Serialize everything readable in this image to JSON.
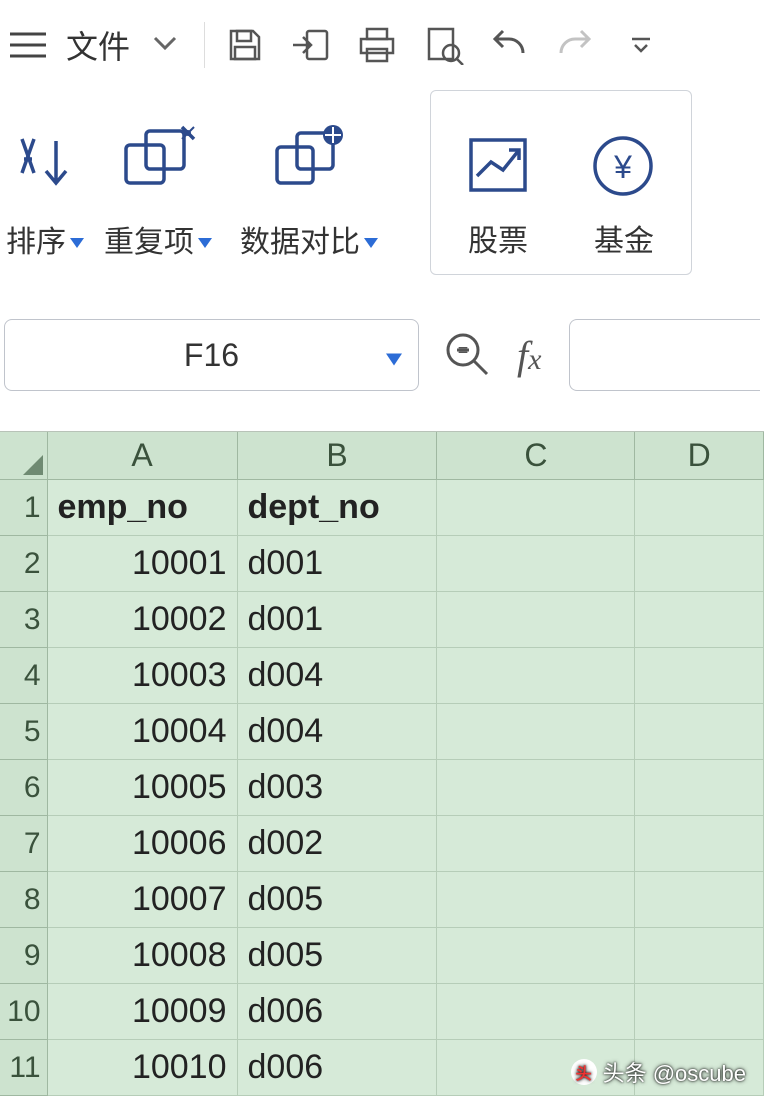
{
  "toolbar": {
    "file_label": "文件"
  },
  "ribbon": {
    "sort_label": "排序",
    "duplicates_label": "重复项",
    "compare_label": "数据对比",
    "stock_label": "股票",
    "fund_label": "基金"
  },
  "namebox": {
    "value": "F16"
  },
  "sheet": {
    "columns": [
      "A",
      "B",
      "C",
      "D"
    ],
    "rows": [
      {
        "n": "1",
        "A": "emp_no",
        "B": "dept_no",
        "header": true
      },
      {
        "n": "2",
        "A": "10001",
        "B": "d001"
      },
      {
        "n": "3",
        "A": "10002",
        "B": "d001"
      },
      {
        "n": "4",
        "A": "10003",
        "B": "d004"
      },
      {
        "n": "5",
        "A": "10004",
        "B": "d004"
      },
      {
        "n": "6",
        "A": "10005",
        "B": "d003"
      },
      {
        "n": "7",
        "A": "10006",
        "B": "d002"
      },
      {
        "n": "8",
        "A": "10007",
        "B": "d005"
      },
      {
        "n": "9",
        "A": "10008",
        "B": "d005"
      },
      {
        "n": "10",
        "A": "10009",
        "B": "d006"
      },
      {
        "n": "11",
        "A": "10010",
        "B": "d006"
      }
    ]
  },
  "watermark": {
    "text": "头条 @oscube"
  },
  "chart_data": {
    "type": "table",
    "title": "",
    "columns": [
      "emp_no",
      "dept_no"
    ],
    "rows": [
      [
        10001,
        "d001"
      ],
      [
        10002,
        "d001"
      ],
      [
        10003,
        "d004"
      ],
      [
        10004,
        "d004"
      ],
      [
        10005,
        "d003"
      ],
      [
        10006,
        "d002"
      ],
      [
        10007,
        "d005"
      ],
      [
        10008,
        "d005"
      ],
      [
        10009,
        "d006"
      ],
      [
        10010,
        "d006"
      ]
    ]
  }
}
